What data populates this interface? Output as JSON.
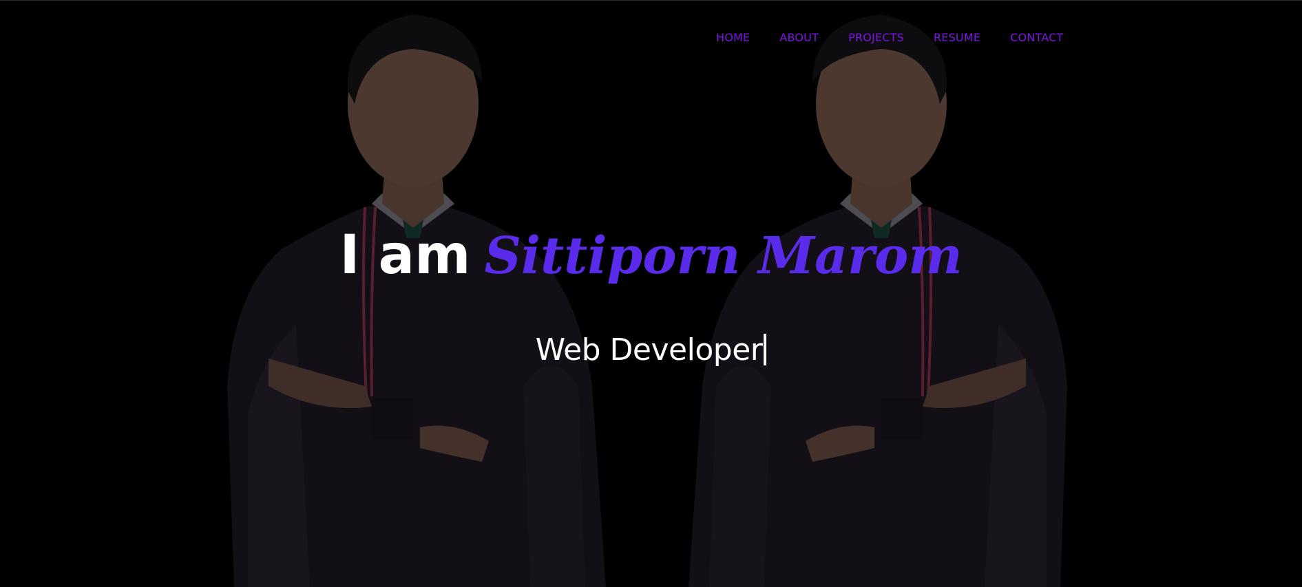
{
  "nav": {
    "items": [
      {
        "label": "HOME"
      },
      {
        "label": "ABOUT"
      },
      {
        "label": "PROJECTS"
      },
      {
        "label": "RESUME"
      },
      {
        "label": "CONTACT"
      }
    ]
  },
  "hero": {
    "prefix": "I am",
    "name": "Sittiporn Marom",
    "role": "Web Developer"
  },
  "colors": {
    "background": "#000000",
    "accent": "#5a2bea",
    "nav": "#7c15e6",
    "text": "#ffffff"
  }
}
